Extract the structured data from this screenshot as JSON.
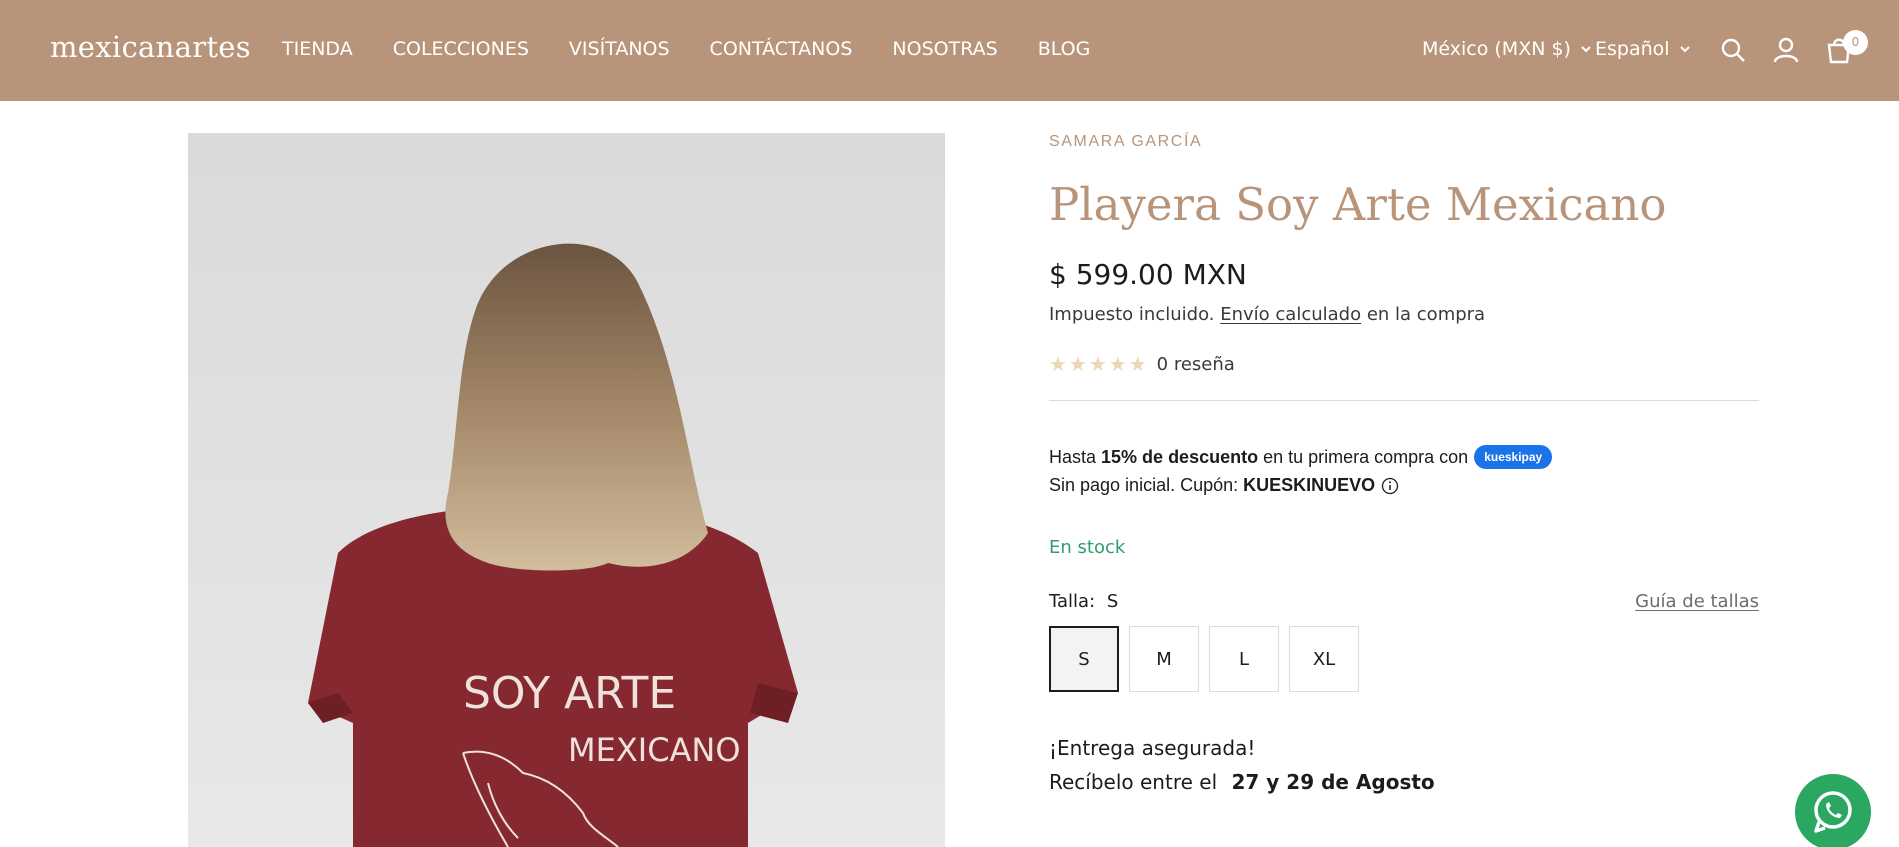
{
  "header": {
    "logo": "mexicanartes",
    "nav": [
      "TIENDA",
      "COLECCIONES",
      "VISÍTANOS",
      "CONTÁCTANOS",
      "NOSOTRAS",
      "BLOG"
    ],
    "currency": "México (MXN $)",
    "language": "Español",
    "cart_count": "0"
  },
  "product": {
    "vendor": "SAMARA GARCÍA",
    "title": "Playera Soy Arte Mexicano",
    "price": "$ 599.00 MXN",
    "tax_prefix": "Impuesto incluido.",
    "tax_link": "Envío calculado",
    "tax_suffix": "en la compra",
    "stars": "★★★★★",
    "rating_value": 0,
    "reviews": "0 reseña",
    "kueski_prefix": "Hasta",
    "kueski_bold": "15% de descuento",
    "kueski_suffix": "en tu primera compra con",
    "kueski_badge": "kueskipay",
    "kueski_line2_prefix": "Sin pago inicial. Cupón:",
    "kueski_coupon": "KUESKINUEVO",
    "stock": "En stock",
    "size_label": "Talla:",
    "size_selected": "S",
    "size_guide": "Guía de tallas",
    "sizes": [
      "S",
      "M",
      "L",
      "XL"
    ],
    "delivery_title": "¡Entrega asegurada!",
    "delivery_prefix": "Recíbelo entre el",
    "delivery_dates": "27 y 29 de Agosto"
  },
  "image": {
    "shirt_line1": "SOY ARTE",
    "shirt_line2": "MEXICANO"
  },
  "colors": {
    "header_bg": "#b8957a",
    "accent": "#b8957a",
    "stock_green": "#2f9d6e",
    "whatsapp": "#2aa862",
    "kueski_blue": "#1a73e8"
  }
}
